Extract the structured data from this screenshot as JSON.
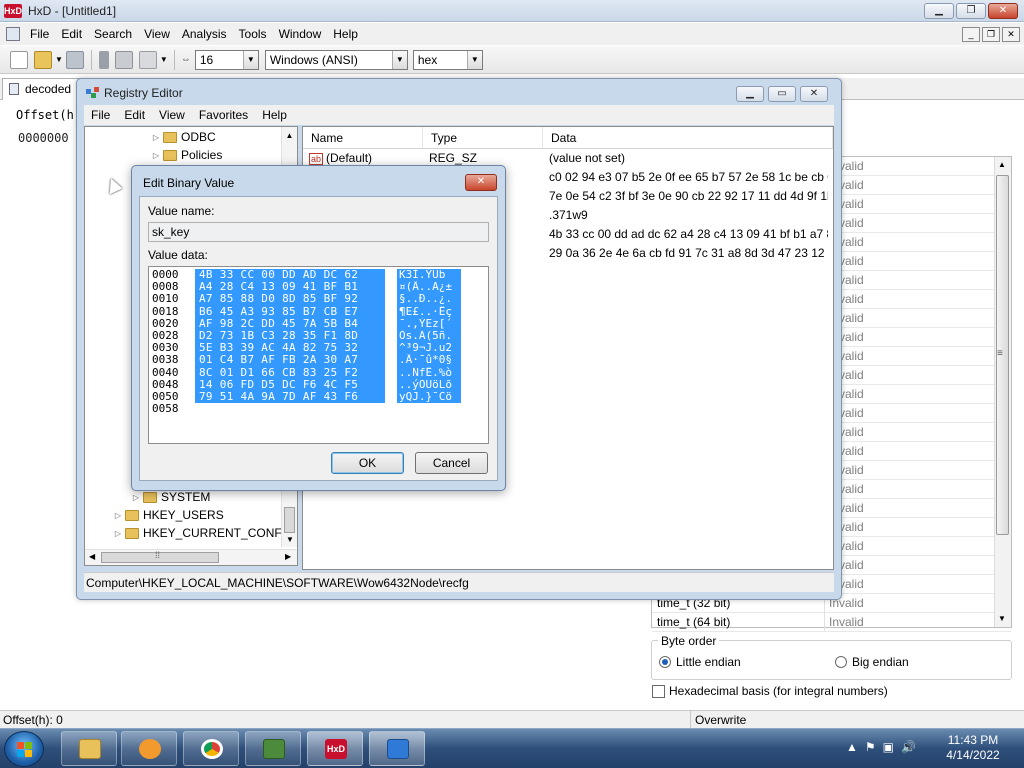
{
  "hxd": {
    "title": "HxD - [Untitled1]",
    "menu": [
      "File",
      "Edit",
      "Search",
      "View",
      "Analysis",
      "Tools",
      "Window",
      "Help"
    ],
    "toolbar": {
      "bytes_per_row": "16",
      "charset": "Windows (ANSI)",
      "base": "hex"
    },
    "tab": "decoded",
    "offset_header": "Offset(h)",
    "offset_first": "0000000",
    "inspector_rows": [
      {
        "name": "",
        "value": "Invalid"
      },
      {
        "name": "",
        "value": "Invalid"
      },
      {
        "name": "",
        "value": "Invalid"
      },
      {
        "name": "",
        "value": "Invalid"
      },
      {
        "name": "",
        "value": "Invalid"
      },
      {
        "name": "",
        "value": "Invalid"
      },
      {
        "name": "",
        "value": "Invalid"
      },
      {
        "name": "",
        "value": "Invalid"
      },
      {
        "name": "",
        "value": "Invalid"
      },
      {
        "name": "",
        "value": "Invalid"
      },
      {
        "name": "",
        "value": "Invalid"
      },
      {
        "name": "",
        "value": "Invalid"
      },
      {
        "name": "",
        "value": "Invalid"
      },
      {
        "name": "",
        "value": "Invalid"
      },
      {
        "name": "",
        "value": "Invalid"
      },
      {
        "name": "",
        "value": "Invalid"
      },
      {
        "name": "",
        "value": "Invalid"
      },
      {
        "name": "",
        "value": "Invalid"
      },
      {
        "name": "",
        "value": "Invalid"
      },
      {
        "name": "",
        "value": "Invalid"
      },
      {
        "name": "",
        "value": "Invalid"
      },
      {
        "name": "",
        "value": "Invalid"
      },
      {
        "name": "",
        "value": "Invalid"
      },
      {
        "name": "time_t (32 bit)",
        "value": "Invalid"
      },
      {
        "name": "time_t (64 bit)",
        "value": "Invalid"
      }
    ],
    "byte_order": {
      "label": "Byte order",
      "little": "Little endian",
      "big": "Big endian",
      "selected": "little"
    },
    "hex_basis": "Hexadecimal basis (for integral numbers)",
    "status": {
      "offset": "Offset(h): 0",
      "mode": "Overwrite"
    }
  },
  "registry": {
    "title": "Registry Editor",
    "menu": [
      "File",
      "Edit",
      "View",
      "Favorites",
      "Help"
    ],
    "tree": [
      {
        "label": "ODBC",
        "indent": 1
      },
      {
        "label": "Policies",
        "indent": 1
      },
      {
        "label": "SYSTEM",
        "indent": 0
      },
      {
        "label": "HKEY_USERS",
        "indent": -1
      },
      {
        "label": "HKEY_CURRENT_CONFIG",
        "indent": -1
      }
    ],
    "columns": [
      "Name",
      "Type",
      "Data"
    ],
    "rows": [
      {
        "name": "(Default)",
        "type": "REG_SZ",
        "data": "(value not set)"
      },
      {
        "name": "",
        "type": "",
        "data": "c0 02 94 e3 07 b5 2e 0f ee 65 b7 57 2e 58 1c be cb 0f..."
      },
      {
        "name": "",
        "type": "",
        "data": "7e 0e 54 c2 3f bf 3e 0e 90 cb 22 92 17 11 dd 4d 9f 1b..."
      },
      {
        "name": "",
        "type": "",
        "data": ".371w9"
      },
      {
        "name": "",
        "type": "",
        "data": "4b 33 cc 00 dd ad dc 62 a4 28 c4 13 09 41 bf b1 a7 8..."
      },
      {
        "name": "",
        "type": "",
        "data": "29 0a 36 2e 4e 6a cb fd 91 7c 31 a8 8d 3d 47 23 12 e..."
      }
    ],
    "status_path": "Computer\\HKEY_LOCAL_MACHINE\\SOFTWARE\\Wow6432Node\\recfg"
  },
  "dialog": {
    "title": "Edit Binary Value",
    "value_name_label": "Value name:",
    "value_name": "sk_key",
    "value_data_label": "Value data:",
    "lines": [
      {
        "off": "0000",
        "hex": "4B 33 CC 00 DD AD DC 62",
        "asc": "K3Ì.Ý­Üb"
      },
      {
        "off": "0008",
        "hex": "A4 28 C4 13 09 41 BF B1",
        "asc": "¤(Ä..A¿±"
      },
      {
        "off": "0010",
        "hex": "A7 85 88 D0 8D 85 BF 92",
        "asc": "§..Ð..¿."
      },
      {
        "off": "0018",
        "hex": "B6 45 A3 93 85 B7 CB E7",
        "asc": "¶E£..·Ëç"
      },
      {
        "off": "0020",
        "hex": "AF 98 2C DD 45 7A 5B B4",
        "asc": "¯.,ÝEz[´"
      },
      {
        "off": "0028",
        "hex": "D2 73 1B C3 28 35 F1 8D",
        "asc": "Òs.Ã(5ñ."
      },
      {
        "off": "0030",
        "hex": "5E B3 39 AC 4A 82 75 32",
        "asc": "^³9¬J.u2"
      },
      {
        "off": "0038",
        "hex": "01 C4 B7 AF FB 2A 30 A7",
        "asc": ".Ä·¯û*0§"
      },
      {
        "off": "0040",
        "hex": "8C 01 D1 66 CB 83 25 F2",
        "asc": "..ÑfË.%ò"
      },
      {
        "off": "0048",
        "hex": "14 06 FD D5 DC F6 4C F5",
        "asc": "..ýÕÜöLõ"
      },
      {
        "off": "0050",
        "hex": "79 51 4A 9A 7D AF 43 F6",
        "asc": "yQJ.}¯Cö"
      },
      {
        "off": "0058",
        "hex": "",
        "asc": ""
      }
    ],
    "ok": "OK",
    "cancel": "Cancel"
  },
  "taskbar": {
    "time": "11:43 PM",
    "date": "4/14/2022"
  }
}
